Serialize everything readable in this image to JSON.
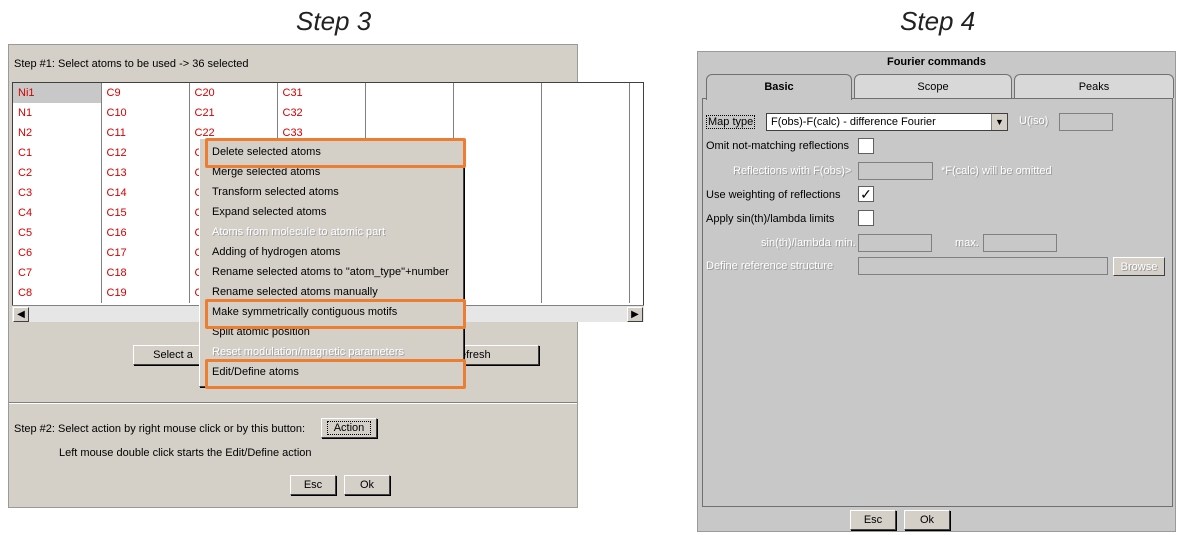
{
  "step_titles": {
    "left": "Step 3",
    "right": "Step 4"
  },
  "left_dialog": {
    "step1_label": "Step #1: Select atoms to be used  -> 36 selected",
    "grid_columns": [
      [
        "Ni1",
        "N1",
        "N2",
        "C1",
        "C2",
        "C3",
        "C4",
        "C5",
        "C6",
        "C7",
        "C8"
      ],
      [
        "C9",
        "C10",
        "C11",
        "C12",
        "C13",
        "C14",
        "C15",
        "C16",
        "C17",
        "C18",
        "C19"
      ],
      [
        "C20",
        "C21",
        "C22",
        "C",
        "C",
        "C",
        "C",
        "C",
        "C",
        "C",
        "C"
      ],
      [
        "C31",
        "C32",
        "C33",
        "",
        "",
        "",
        "",
        "",
        "",
        "",
        ""
      ],
      [
        "",
        "",
        "",
        "",
        "",
        "",
        "",
        "",
        "",
        "",
        ""
      ],
      [
        "",
        "",
        "",
        "",
        "",
        "",
        "",
        "",
        "",
        "",
        ""
      ],
      [
        "",
        "",
        "",
        "",
        "",
        "",
        "",
        "",
        "",
        "",
        ""
      ]
    ],
    "select_button_partial": "Select a",
    "refresh_button_partial": "efresh",
    "step2_label": "Step #2: Select action by right mouse click or by this button:",
    "action_button": "Action",
    "hint": "Left mouse double click starts the Edit/Define action",
    "esc_button": "Esc",
    "ok_button": "Ok"
  },
  "context_menu": {
    "items": [
      {
        "label": "Delete selected atoms",
        "enabled": true
      },
      {
        "label": "Merge selected atoms",
        "enabled": true
      },
      {
        "label": "Transform selected atoms",
        "enabled": true
      },
      {
        "label": "Expand selected atoms",
        "enabled": true
      },
      {
        "label": "Atoms from molecule to atomic part",
        "enabled": false
      },
      {
        "label": "Adding of hydrogen atoms",
        "enabled": true
      },
      {
        "label": "Rename selected atoms to \"atom_type\"+number",
        "enabled": true
      },
      {
        "label": "Rename selected atoms manually",
        "enabled": true
      },
      {
        "label": "Make symmetrically contiguous motifs",
        "enabled": true
      },
      {
        "label": "Split atomic position",
        "enabled": true
      },
      {
        "label": "Reset modulation/magnetic parameters",
        "enabled": false
      },
      {
        "label": "Edit/Define atoms",
        "enabled": true
      }
    ],
    "highlight_color": "#ed7d31"
  },
  "right_dialog": {
    "title": "Fourier commands",
    "tabs": [
      "Basic",
      "Scope",
      "Peaks"
    ],
    "active_tab": "Basic",
    "map_type_label": "Map type",
    "map_type_value": "F(obs)-F(calc) - difference Fourier",
    "uiso_label": "U(iso)",
    "omit_label": "Omit not-matching reflections",
    "omit_checked": false,
    "reflections_label": "Reflections with F(obs)>",
    "fcalc_note": "*F(calc) will be omitted",
    "weighting_label": "Use weighting of reflections",
    "weighting_checked": true,
    "apply_label": "Apply sin(th)/lambda limits",
    "apply_checked": false,
    "sinth_label": "sin(th)/lambda",
    "min_label": "min.",
    "max_label": "max.",
    "define_ref_label": "Define reference structure",
    "browse_button": "Browse",
    "esc_button": "Esc",
    "ok_button": "Ok"
  }
}
